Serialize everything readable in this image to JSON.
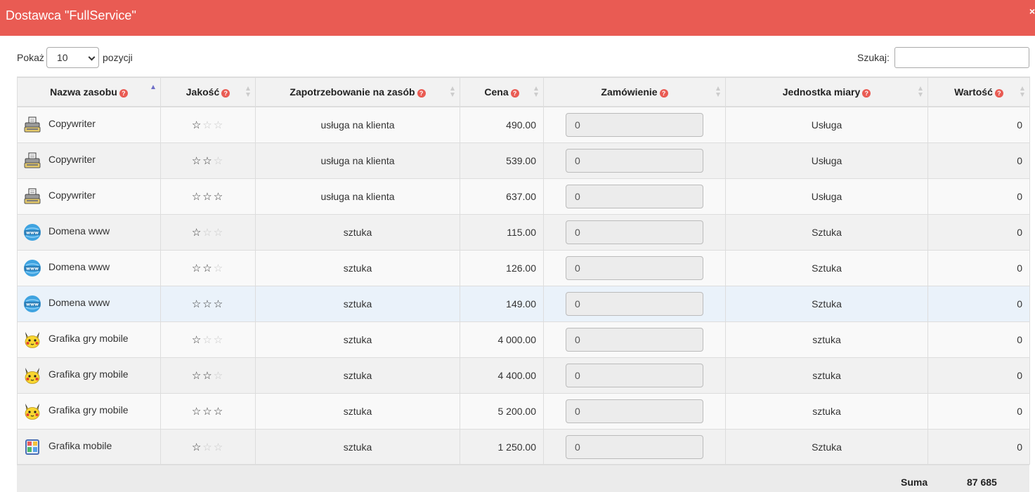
{
  "dialog": {
    "title": "Dostawca \"FullService\"",
    "close_glyph": "×"
  },
  "controls": {
    "show_label": "Pokaż",
    "show_value": "10",
    "show_suffix": "pozycji",
    "search_label": "Szukaj:",
    "search_value": ""
  },
  "columns": [
    "Nazwa zasobu",
    "Jakość",
    "Zapotrzebowanie na zasób",
    "Cena",
    "Zamówienie",
    "Jednostka miary",
    "Wartość"
  ],
  "help_glyph": "?",
  "rows": [
    {
      "icon": "typewriter-icon",
      "name": "Copywriter",
      "stars": 1,
      "demand": "usługa na klienta",
      "price": "490.00",
      "order": "0",
      "unit": "Usługa",
      "value": "0"
    },
    {
      "icon": "typewriter-icon",
      "name": "Copywriter",
      "stars": 2,
      "demand": "usługa na klienta",
      "price": "539.00",
      "order": "0",
      "unit": "Usługa",
      "value": "0"
    },
    {
      "icon": "typewriter-icon",
      "name": "Copywriter",
      "stars": 3,
      "demand": "usługa na klienta",
      "price": "637.00",
      "order": "0",
      "unit": "Usługa",
      "value": "0"
    },
    {
      "icon": "globe-www-icon",
      "name": "Domena www",
      "stars": 1,
      "demand": "sztuka",
      "price": "115.00",
      "order": "0",
      "unit": "Sztuka",
      "value": "0"
    },
    {
      "icon": "globe-www-icon",
      "name": "Domena www",
      "stars": 2,
      "demand": "sztuka",
      "price": "126.00",
      "order": "0",
      "unit": "Sztuka",
      "value": "0"
    },
    {
      "icon": "globe-www-icon",
      "name": "Domena www",
      "stars": 3,
      "demand": "sztuka",
      "price": "149.00",
      "order": "0",
      "unit": "Sztuka",
      "value": "0"
    },
    {
      "icon": "pikachu-icon",
      "name": "Grafika gry mobile",
      "stars": 1,
      "demand": "sztuka",
      "price": "4 000.00",
      "order": "0",
      "unit": "sztuka",
      "value": "0"
    },
    {
      "icon": "pikachu-icon",
      "name": "Grafika gry mobile",
      "stars": 2,
      "demand": "sztuka",
      "price": "4 400.00",
      "order": "0",
      "unit": "sztuka",
      "value": "0"
    },
    {
      "icon": "pikachu-icon",
      "name": "Grafika gry mobile",
      "stars": 3,
      "demand": "sztuka",
      "price": "5 200.00",
      "order": "0",
      "unit": "sztuka",
      "value": "0"
    },
    {
      "icon": "mobile-app-icon",
      "name": "Grafika mobile",
      "stars": 1,
      "demand": "sztuka",
      "price": "1 250.00",
      "order": "0",
      "unit": "Sztuka",
      "value": "0"
    }
  ],
  "footer": {
    "sum_label": "Suma",
    "sum_value": "87 685"
  },
  "colors": {
    "header_bar": "#e95b53",
    "help_badge": "#e95b53",
    "sort_active": "#6f6fc7"
  }
}
